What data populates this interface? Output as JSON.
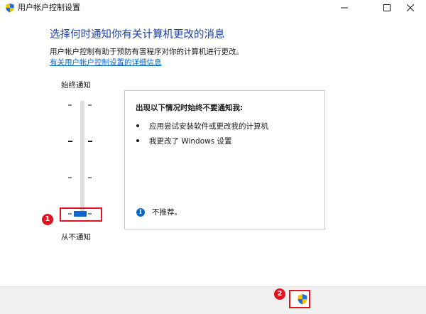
{
  "window": {
    "title": "用户帐户控制设置",
    "icon": "uac-shield-icon",
    "controls": [
      "minimize-icon",
      "maximize-icon",
      "close-icon"
    ]
  },
  "main": {
    "heading": "选择何时通知你有关计算机更改的消息",
    "description": "用户帐户控制有助于预防有害程序对你的计算机进行更改。",
    "link": "有关用户帐户控制设置的详细信息"
  },
  "slider": {
    "top_label": "始终通知",
    "bottom_label": "从不通知",
    "levels": 4,
    "selected_level": 1,
    "selected_level_note": "1 = lowest (bottom) of 4 levels"
  },
  "info": {
    "title": "出现以下情况时始终不要通知我:",
    "items": [
      "应用尝试安装软件或更改我的计算机",
      "我更改了 Windows 设置"
    ],
    "note": "不推荐。",
    "note_icon": "info-icon"
  },
  "annotations": {
    "marker1": "1",
    "marker2": "2"
  },
  "footer": {
    "ok_icon": "uac-shield-icon"
  },
  "colors": {
    "heading": "#1c3fa8",
    "link": "#0066cc",
    "thumb": "#0a66c8",
    "annotation": "#e0141e"
  }
}
